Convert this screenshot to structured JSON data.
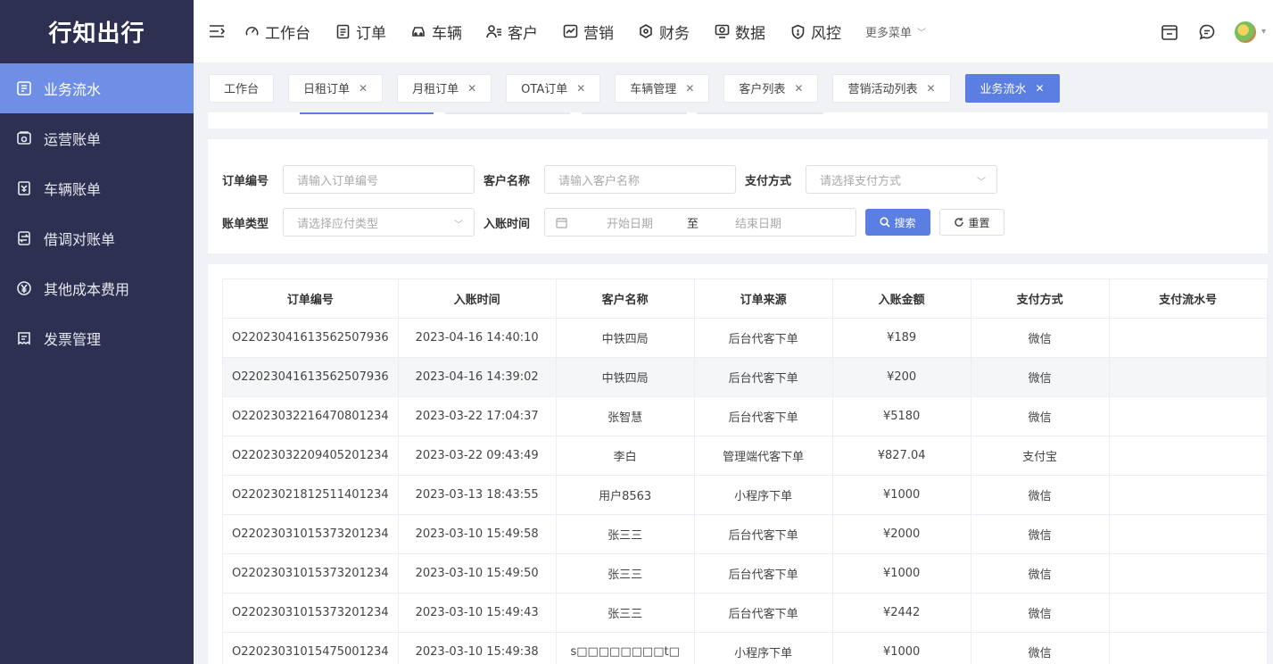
{
  "brand": "行知出行",
  "sidebar": {
    "items": [
      {
        "label": "业务流水",
        "icon": "ledger-icon",
        "active": true
      },
      {
        "label": "运营账单",
        "icon": "bill-icon",
        "active": false
      },
      {
        "label": "车辆账单",
        "icon": "vehicle-bill-icon",
        "active": false
      },
      {
        "label": "借调对账单",
        "icon": "transfer-icon",
        "active": false
      },
      {
        "label": "其他成本费用",
        "icon": "yen-icon",
        "active": false
      },
      {
        "label": "发票管理",
        "icon": "invoice-icon",
        "active": false
      }
    ]
  },
  "topnav": {
    "items": [
      {
        "label": "工作台",
        "icon": "dashboard-icon"
      },
      {
        "label": "订单",
        "icon": "order-icon"
      },
      {
        "label": "车辆",
        "icon": "car-icon"
      },
      {
        "label": "客户",
        "icon": "customer-icon"
      },
      {
        "label": "营销",
        "icon": "marketing-icon"
      },
      {
        "label": "财务",
        "icon": "finance-icon"
      },
      {
        "label": "数据",
        "icon": "data-icon"
      },
      {
        "label": "风控",
        "icon": "risk-icon"
      }
    ],
    "more": "更多菜单"
  },
  "tabs": [
    {
      "label": "工作台",
      "closable": false,
      "active": false
    },
    {
      "label": "日租订单",
      "closable": true,
      "active": false
    },
    {
      "label": "月租订单",
      "closable": true,
      "active": false
    },
    {
      "label": "OTA订单",
      "closable": true,
      "active": false
    },
    {
      "label": "车辆管理",
      "closable": true,
      "active": false
    },
    {
      "label": "客户列表",
      "closable": true,
      "active": false
    },
    {
      "label": "营销活动列表",
      "closable": true,
      "active": false
    },
    {
      "label": "业务流水",
      "closable": true,
      "active": true
    }
  ],
  "form": {
    "order_no_label": "订单编号",
    "order_no_placeholder": "请输入订单编号",
    "customer_label": "客户名称",
    "customer_placeholder": "请输入客户名称",
    "pay_method_label": "支付方式",
    "pay_method_placeholder": "请选择支付方式",
    "bill_type_label": "账单类型",
    "bill_type_placeholder": "请选择应付类型",
    "time_label": "入账时间",
    "start_placeholder": "开始日期",
    "range_sep": "至",
    "end_placeholder": "结束日期",
    "search_btn": "搜索",
    "reset_btn": "重置"
  },
  "table": {
    "columns": [
      "订单编号",
      "入账时间",
      "客户名称",
      "订单来源",
      "入账金额",
      "支付方式",
      "支付流水号"
    ],
    "rows": [
      [
        "O22023041613562507936",
        "2023-04-16 14:40:10",
        "中铁四局",
        "后台代客下单",
        "¥189",
        "微信",
        ""
      ],
      [
        "O22023041613562507936",
        "2023-04-16 14:39:02",
        "中铁四局",
        "后台代客下单",
        "¥200",
        "微信",
        ""
      ],
      [
        "O22023032216470801234",
        "2023-03-22 17:04:37",
        "张智慧",
        "后台代客下单",
        "¥5180",
        "微信",
        ""
      ],
      [
        "O22023032209405201234",
        "2023-03-22 09:43:49",
        "李白",
        "管理端代客下单",
        "¥827.04",
        "支付宝",
        ""
      ],
      [
        "O22023021812511401234",
        "2023-03-13 18:43:55",
        "用户8563",
        "小程序下单",
        "¥1000",
        "微信",
        ""
      ],
      [
        "O22023031015373201234",
        "2023-03-10 15:49:58",
        "张三三",
        "后台代客下单",
        "¥2000",
        "微信",
        ""
      ],
      [
        "O22023031015373201234",
        "2023-03-10 15:49:50",
        "张三三",
        "后台代客下单",
        "¥1000",
        "微信",
        ""
      ],
      [
        "O22023031015373201234",
        "2023-03-10 15:49:43",
        "张三三",
        "后台代客下单",
        "¥2442",
        "微信",
        ""
      ],
      [
        "O22023031015475001234",
        "2023-03-10 15:49:38",
        "s□□□□□□□□t□",
        "小程序下单",
        "¥1000",
        "微信",
        ""
      ]
    ]
  },
  "colors": {
    "sidebar_bg": "#2d3050",
    "active_blue": "#5b7ee3",
    "sidebar_active": "#6f8fe6"
  }
}
